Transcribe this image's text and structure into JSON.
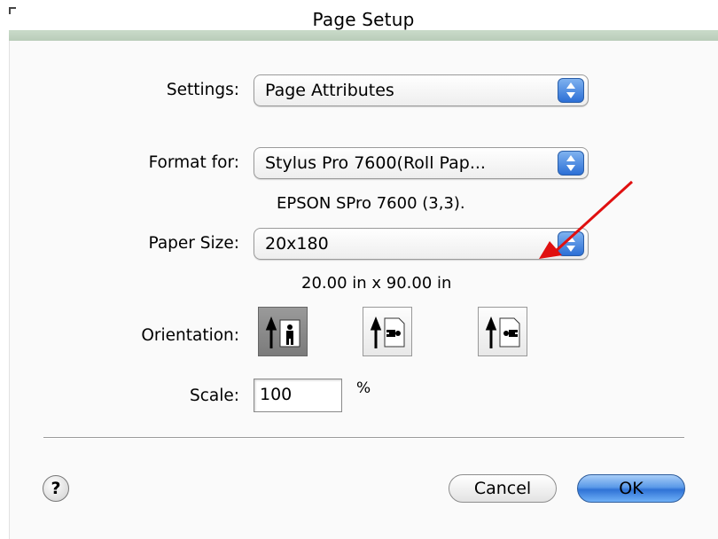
{
  "window": {
    "title": "Page Setup"
  },
  "settings": {
    "label": "Settings:",
    "value": "Page Attributes"
  },
  "format_for": {
    "label": "Format for:",
    "value": "Stylus Pro 7600(Roll Pap...",
    "printer_info": "EPSON SPro 7600 (3,3)."
  },
  "paper_size": {
    "label": "Paper Size:",
    "value": "20x180",
    "dimensions": "20.00 in x 90.00 in"
  },
  "orientation": {
    "label": "Orientation:",
    "options": [
      {
        "name": "portrait",
        "selected": true
      },
      {
        "name": "landscape",
        "selected": false
      },
      {
        "name": "reverse-landscape",
        "selected": false
      }
    ]
  },
  "scale": {
    "label": "Scale:",
    "value": "100",
    "unit": "%"
  },
  "buttons": {
    "help": "?",
    "cancel": "Cancel",
    "ok": "OK"
  },
  "annotation": {
    "arrow_color": "#e01010"
  }
}
